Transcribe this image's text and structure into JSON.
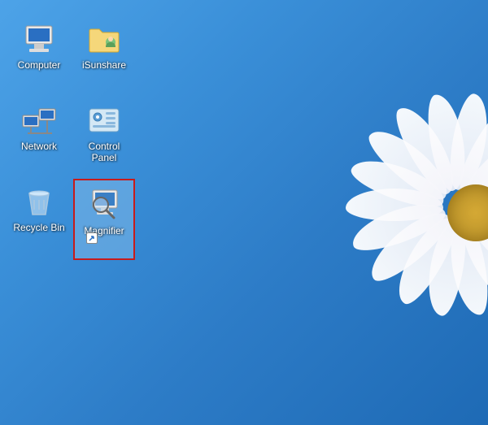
{
  "desktop": {
    "icons": [
      {
        "id": "computer",
        "label": "Computer"
      },
      {
        "id": "isunshare",
        "label": "iSunshare"
      },
      {
        "id": "network",
        "label": "Network"
      },
      {
        "id": "control-panel",
        "label": "Control Panel"
      },
      {
        "id": "recycle-bin",
        "label": "Recycle Bin"
      },
      {
        "id": "magnifier",
        "label": "Magnifier"
      }
    ],
    "highlighted_id": "magnifier"
  }
}
